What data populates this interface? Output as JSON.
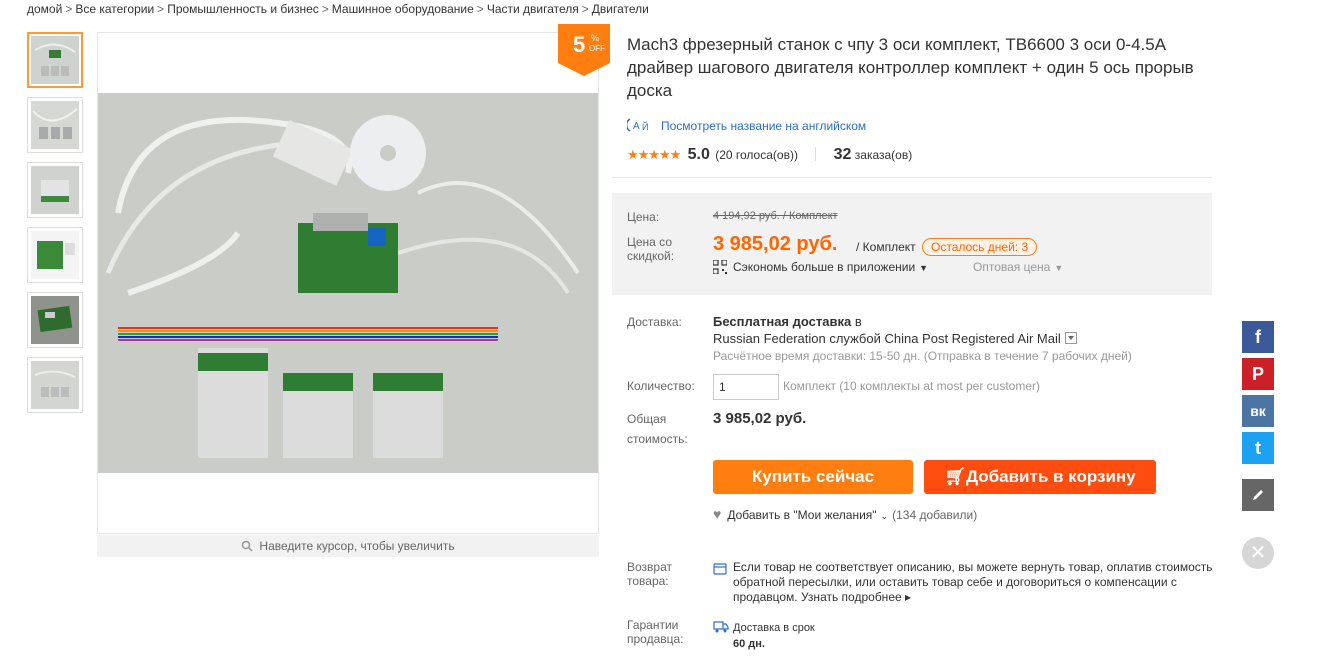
{
  "breadcrumb": [
    "домой",
    "Все категории",
    "Промышленность и бизнес",
    "Машинное оборудование",
    "Части двигателя",
    "Двигатели"
  ],
  "breadcrumb_sep": ">",
  "thumbnails_count": 6,
  "zoom_hint": "Наведите курсор, чтобы увеличить",
  "discount": {
    "value": "5",
    "percent": "%",
    "off": "OFF"
  },
  "product": {
    "title": "Mach3 фрезерный станок с чпу 3 оси комплект, TB6600 3 оси 0-4.5A драйвер шагового двигателя контроллер комплект + один 5 ось прорыв доска",
    "translate_link": "Посмотреть название на английском",
    "rating_score": "5.0",
    "rating_votes": "(20 голоса(ов))",
    "orders_count": "32",
    "orders_label": "заказа(ов)"
  },
  "price": {
    "label_price": "Цена:",
    "old_price": "4 194,92 руб. / Комплект",
    "label_discount_1": "Цена со",
    "label_discount_2": "скидкой:",
    "new_price": "3 985,02 руб.",
    "unit": "/ Комплект",
    "days_left": "Осталось дней: 3",
    "app_save": "Сэкономь больше в приложении",
    "wholesale": "Оптовая цена"
  },
  "delivery": {
    "label": "Доставка:",
    "free": "Бесплатная доставка",
    "to": "в",
    "destination": "Russian Federation службой China Post Registered Air Mail",
    "estimate": "Расчётное время доставки: 15-50 дн. (Отправка в течение 7 рабочих дней)"
  },
  "quantity": {
    "label": "Количество:",
    "value": "1",
    "note": "Комплект (10 комплекты at most per customer)"
  },
  "total": {
    "label_1": "Общая",
    "label_2": "стоимость:",
    "value": "3 985,02 руб."
  },
  "buttons": {
    "buy": "Купить сейчас",
    "cart": "Добавить в корзину"
  },
  "wishlist": {
    "label": "Добавить в \"Мои желания\"",
    "count": "(134 добавили)"
  },
  "returns": {
    "label_1": "Возврат",
    "label_2": "товара:",
    "text": "Если товар не соответствует описанию, вы можете вернуть товар, оплатив стоимость обратной пересылки, или оставить товар себе и договориться о компенсации с продавцом.",
    "more": "Узнать подробнее"
  },
  "guarantee": {
    "label_1": "Гарантии",
    "label_2": "продавца:",
    "line1": "Доставка в срок",
    "line2": "60 дн."
  },
  "social": [
    {
      "name": "facebook",
      "glyph": "f",
      "color": "#3b5998"
    },
    {
      "name": "pinterest",
      "glyph": "P",
      "color": "#cb2027"
    },
    {
      "name": "vk",
      "glyph": "вк",
      "color": "#4c75a3"
    },
    {
      "name": "twitter",
      "glyph": "t",
      "color": "#1da1f2"
    }
  ],
  "icons": [
    "search-icon",
    "translate-icon",
    "star-icon",
    "qr-icon",
    "chevron-down-icon",
    "dropdown-icon",
    "cart-icon",
    "heart-icon",
    "return-icon",
    "truck-icon",
    "facebook-icon",
    "pinterest-icon",
    "vk-icon",
    "twitter-icon",
    "pencil-icon",
    "close-icon"
  ]
}
